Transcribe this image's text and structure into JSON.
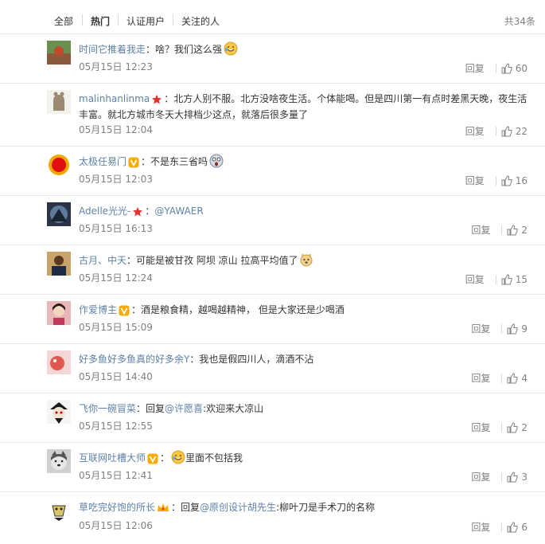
{
  "tabs": [
    {
      "label": "全部",
      "active": false
    },
    {
      "label": "热门",
      "active": true
    },
    {
      "label": "认证用户",
      "active": false
    },
    {
      "label": "关注的人",
      "active": false
    }
  ],
  "total": "共34条",
  "comments": [
    {
      "user": "时间它推着我走",
      "sep": "：",
      "text": "啥？我们这么强",
      "time": "05月15日 12:23",
      "reply": "回复",
      "likes": "60"
    },
    {
      "user": "malinhanlinma",
      "sep": "：",
      "text": "北方人别不服。北方没啥夜生活。个体能喝。但是四川第一有点时差黑天晚，夜生活丰富。就北方城市冬天大排档少这点，就落后很多量了",
      "time": "05月15日 12:04",
      "reply": "回复",
      "likes": "22"
    },
    {
      "user": "太极任易门",
      "sep": "：",
      "text": "不是东三省吗",
      "time": "05月15日 12:03",
      "reply": "回复",
      "likes": "16"
    },
    {
      "user": "Adelle光光-",
      "sep": "：",
      "mention": "@YAWAER",
      "text": "",
      "time": "05月15日 16:13",
      "reply": "回复",
      "likes": "2"
    },
    {
      "user": "古月、中天",
      "sep": "：",
      "text": "可能是被甘孜 阿坝 凉山 拉高平均值了",
      "time": "05月15日 12:24",
      "reply": "回复",
      "likes": "15"
    },
    {
      "user": "作爱博主",
      "sep": "：",
      "text": "酒是粮食精，越喝越精神， 但是大家还是少喝酒",
      "time": "05月15日 15:09",
      "reply": "回复",
      "likes": "9"
    },
    {
      "user": "好多鱼好多鱼真的好多余Y",
      "sep": "：",
      "text": "我也是假四川人，滴酒不沾",
      "time": "05月15日 14:40",
      "reply": "回复",
      "likes": "4"
    },
    {
      "user": "飞你一碗冒菜",
      "sep": "：",
      "prefix": "回复",
      "mention": "@许愿喜",
      "text": ":欢迎来大凉山",
      "time": "05月15日 12:55",
      "reply": "回复",
      "likes": "2"
    },
    {
      "user": "互联网吐槽大师",
      "sep": "：",
      "text": "里面不包括我",
      "time": "05月15日 12:41",
      "reply": "回复",
      "likes": "3"
    },
    {
      "user": "草吃完好饱的所长",
      "sep": "：",
      "prefix": "回复",
      "mention": "@原创设计胡先生",
      "text": ":柳叶刀是手术刀的名称",
      "time": "05月15日 12:06",
      "reply": "回复",
      "likes": "6"
    }
  ]
}
